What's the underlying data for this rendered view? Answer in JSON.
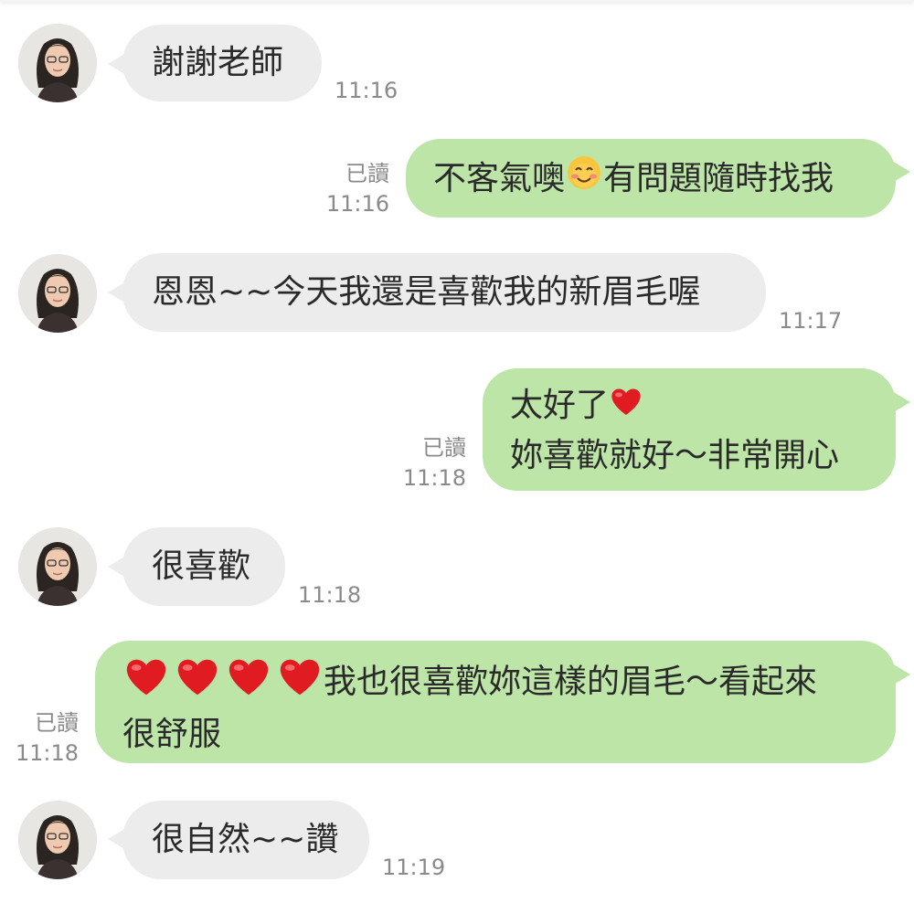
{
  "messages": [
    {
      "id": 1,
      "side": "in",
      "text": "謝謝老師",
      "time": "11:16"
    },
    {
      "id": 2,
      "side": "out",
      "text_a": "不客氣噢",
      "emoji": "smiling-face-emoji",
      "text_b": "有問題隨時找我",
      "read": "已讀",
      "time": "11:16"
    },
    {
      "id": 3,
      "side": "in",
      "text": "恩恩~~今天我還是喜歡我的新眉毛喔",
      "time": "11:17"
    },
    {
      "id": 4,
      "side": "out",
      "line1": "太好了",
      "line1_emoji": "red-heart-emoji",
      "line2": "妳喜歡就好～非常開心",
      "read": "已讀",
      "time": "11:18"
    },
    {
      "id": 5,
      "side": "in",
      "text": "很喜歡",
      "time": "11:18"
    },
    {
      "id": 6,
      "side": "out",
      "hearts": [
        "red-heart-emoji",
        "red-heart-emoji",
        "red-heart-emoji",
        "red-heart-emoji"
      ],
      "line1": "我也很喜歡妳這樣的眉毛～看起來",
      "line2": "很舒服",
      "read": "已讀",
      "time": "11:18"
    },
    {
      "id": 7,
      "side": "in",
      "text": "很自然~~讚",
      "time": "11:19"
    }
  ],
  "colors": {
    "outgoing_bubble": "#bce5a7",
    "incoming_bubble": "#ececec",
    "meta_text": "#8a8a8a",
    "heart": "#e11b22"
  }
}
